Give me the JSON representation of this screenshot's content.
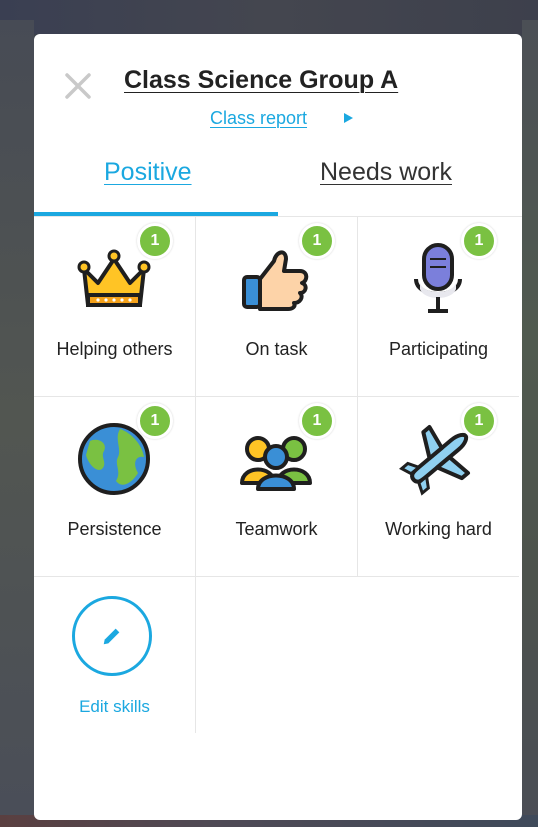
{
  "modal": {
    "title": "Class Science Group A",
    "report_link": "Class report"
  },
  "tabs": [
    {
      "label": "Positive",
      "active": true
    },
    {
      "label": "Needs work",
      "active": false
    }
  ],
  "skills": [
    {
      "label": "Helping others",
      "count": "1",
      "icon": "crown-icon"
    },
    {
      "label": "On task",
      "count": "1",
      "icon": "thumbs-up-icon"
    },
    {
      "label": "Participating",
      "count": "1",
      "icon": "microphone-icon"
    },
    {
      "label": "Persistence",
      "count": "1",
      "icon": "globe-icon"
    },
    {
      "label": "Teamwork",
      "count": "1",
      "icon": "people-icon"
    },
    {
      "label": "Working hard",
      "count": "1",
      "icon": "airplane-icon"
    }
  ],
  "edit_skills": {
    "label": "Edit skills",
    "icon": "pencil-icon"
  },
  "colors": {
    "accent": "#1ba8e0",
    "badge": "#7ac142"
  }
}
